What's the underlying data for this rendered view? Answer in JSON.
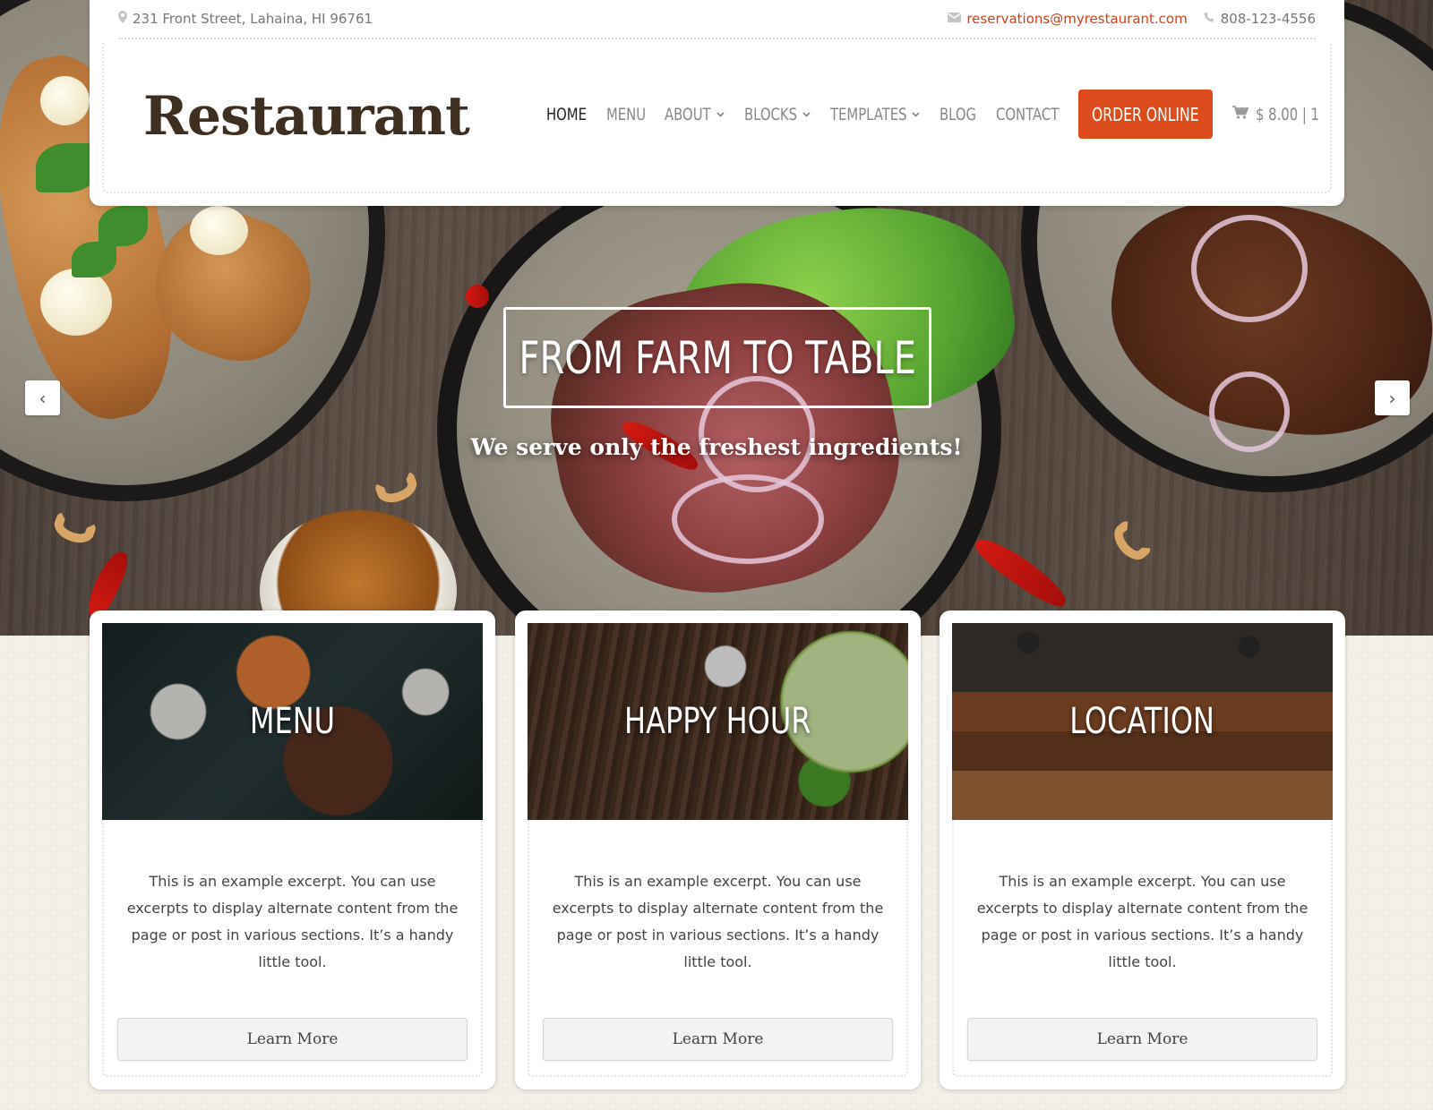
{
  "topbar": {
    "address": "231 Front Street, Lahaina, HI 96761",
    "email": "reservations@myrestaurant.com",
    "phone": "808-123-4556"
  },
  "header": {
    "logo": "Restaurant",
    "nav": [
      {
        "label": "HOME",
        "active": true
      },
      {
        "label": "MENU"
      },
      {
        "label": "ABOUT",
        "dropdown": true
      },
      {
        "label": "BLOCKS",
        "dropdown": true
      },
      {
        "label": "TEMPLATES",
        "dropdown": true
      },
      {
        "label": "BLOG"
      },
      {
        "label": "CONTACT"
      }
    ],
    "order_button": "ORDER ONLINE",
    "cart": "$ 8.00 | 1"
  },
  "hero": {
    "title": "FROM FARM TO TABLE",
    "subtitle": "We serve only the freshest ingredients!",
    "prev_arrow": "‹",
    "next_arrow": "›"
  },
  "cards": [
    {
      "title": "MENU",
      "text": "This is an example excerpt. You can use excerpts to display alternate content from the page or post in various sections. It’s a handy little tool.",
      "button": "Learn More"
    },
    {
      "title": "HAPPY HOUR",
      "text": "This is an example excerpt. You can use excerpts to display alternate content from the page or post in various sections. It’s a handy little tool.",
      "button": "Learn More"
    },
    {
      "title": "LOCATION",
      "text": "This is an example excerpt. You can use excerpts to display alternate content from the page or post in various sections. It’s a handy little tool.",
      "button": "Learn More"
    }
  ],
  "icons": {
    "address": "map-pin-icon",
    "email": "envelope-icon",
    "phone": "phone-icon",
    "cart": "cart-icon",
    "dropdown": "chevron-down-icon"
  },
  "colors": {
    "accent": "#dc4c1d",
    "email_link": "#d4401b",
    "logo": "#3f2f20",
    "page_background": "#f3f0e8"
  }
}
